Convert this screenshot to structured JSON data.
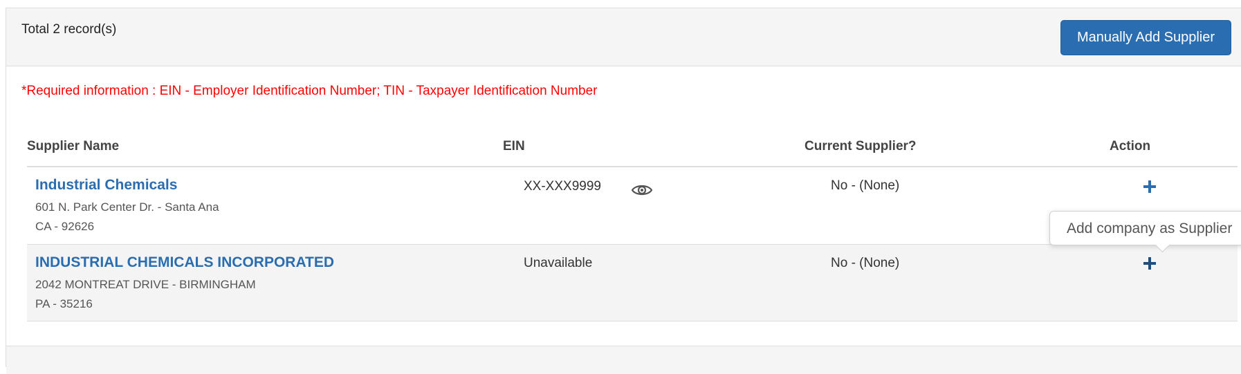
{
  "header": {
    "record_count": "Total 2 record(s)",
    "add_button_label": "Manually Add Supplier"
  },
  "required_note": "*Required information : EIN - Employer Identification Number; TIN - Taxpayer Identification Number",
  "table": {
    "columns": [
      "Supplier Name",
      "EIN",
      "Current Supplier?",
      "Action"
    ],
    "rows": [
      {
        "name": "Industrial Chemicals",
        "address_line1": "601 N. Park Center Dr. - Santa Ana",
        "address_line2": "CA - 92626",
        "ein": "XX-XXX9999",
        "ein_icon": "eye-icon",
        "current_supplier": "No - (None)",
        "action_icon": "plus-icon"
      },
      {
        "name": "INDUSTRIAL CHEMICALS INCORPORATED",
        "address_line1": "2042 MONTREAT DRIVE - BIRMINGHAM",
        "address_line2": "PA - 35216",
        "ein": "Unavailable",
        "current_supplier": "No - (None)",
        "action_icon": "plus-icon"
      }
    ]
  },
  "tooltip": {
    "text": "Add company as Supplier"
  },
  "colors": {
    "accent": "#2a6db0",
    "required_text": "#ff0000",
    "header_bg": "#f5f5f5",
    "alt_row_bg": "#f4f4f4"
  }
}
